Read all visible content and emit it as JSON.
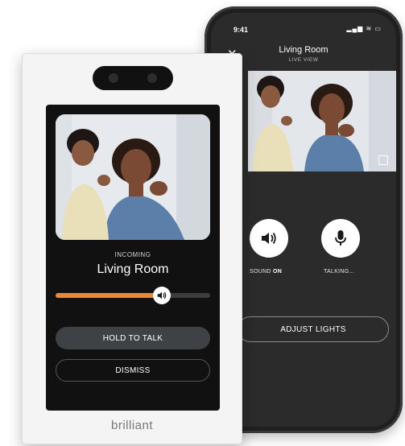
{
  "phone": {
    "status_time": "9:41",
    "status_icons": "▂▄▆ ≋ ▭",
    "title": "Living Room",
    "subtitle": "LIVE VIEW",
    "close_symbol": "✕",
    "sound_label_prefix": "SOUND ",
    "sound_label_state": "ON",
    "talk_label": "TALKING...",
    "adjust_lights_label": "ADJUST LIGHTS"
  },
  "panel": {
    "incoming_label": "INCOMING",
    "room_name": "Living Room",
    "volume_level": 0.69,
    "hold_to_talk_label": "HOLD TO TALK",
    "dismiss_label": "DISMISS",
    "brand": "brilliant"
  },
  "colors": {
    "accent_orange": "#e8893a",
    "screen_black": "#111111",
    "phone_body": "#1f1f20"
  },
  "icons": [
    "close-icon",
    "speaker-icon",
    "microphone-icon",
    "fullscreen-icon",
    "camera-icon"
  ]
}
